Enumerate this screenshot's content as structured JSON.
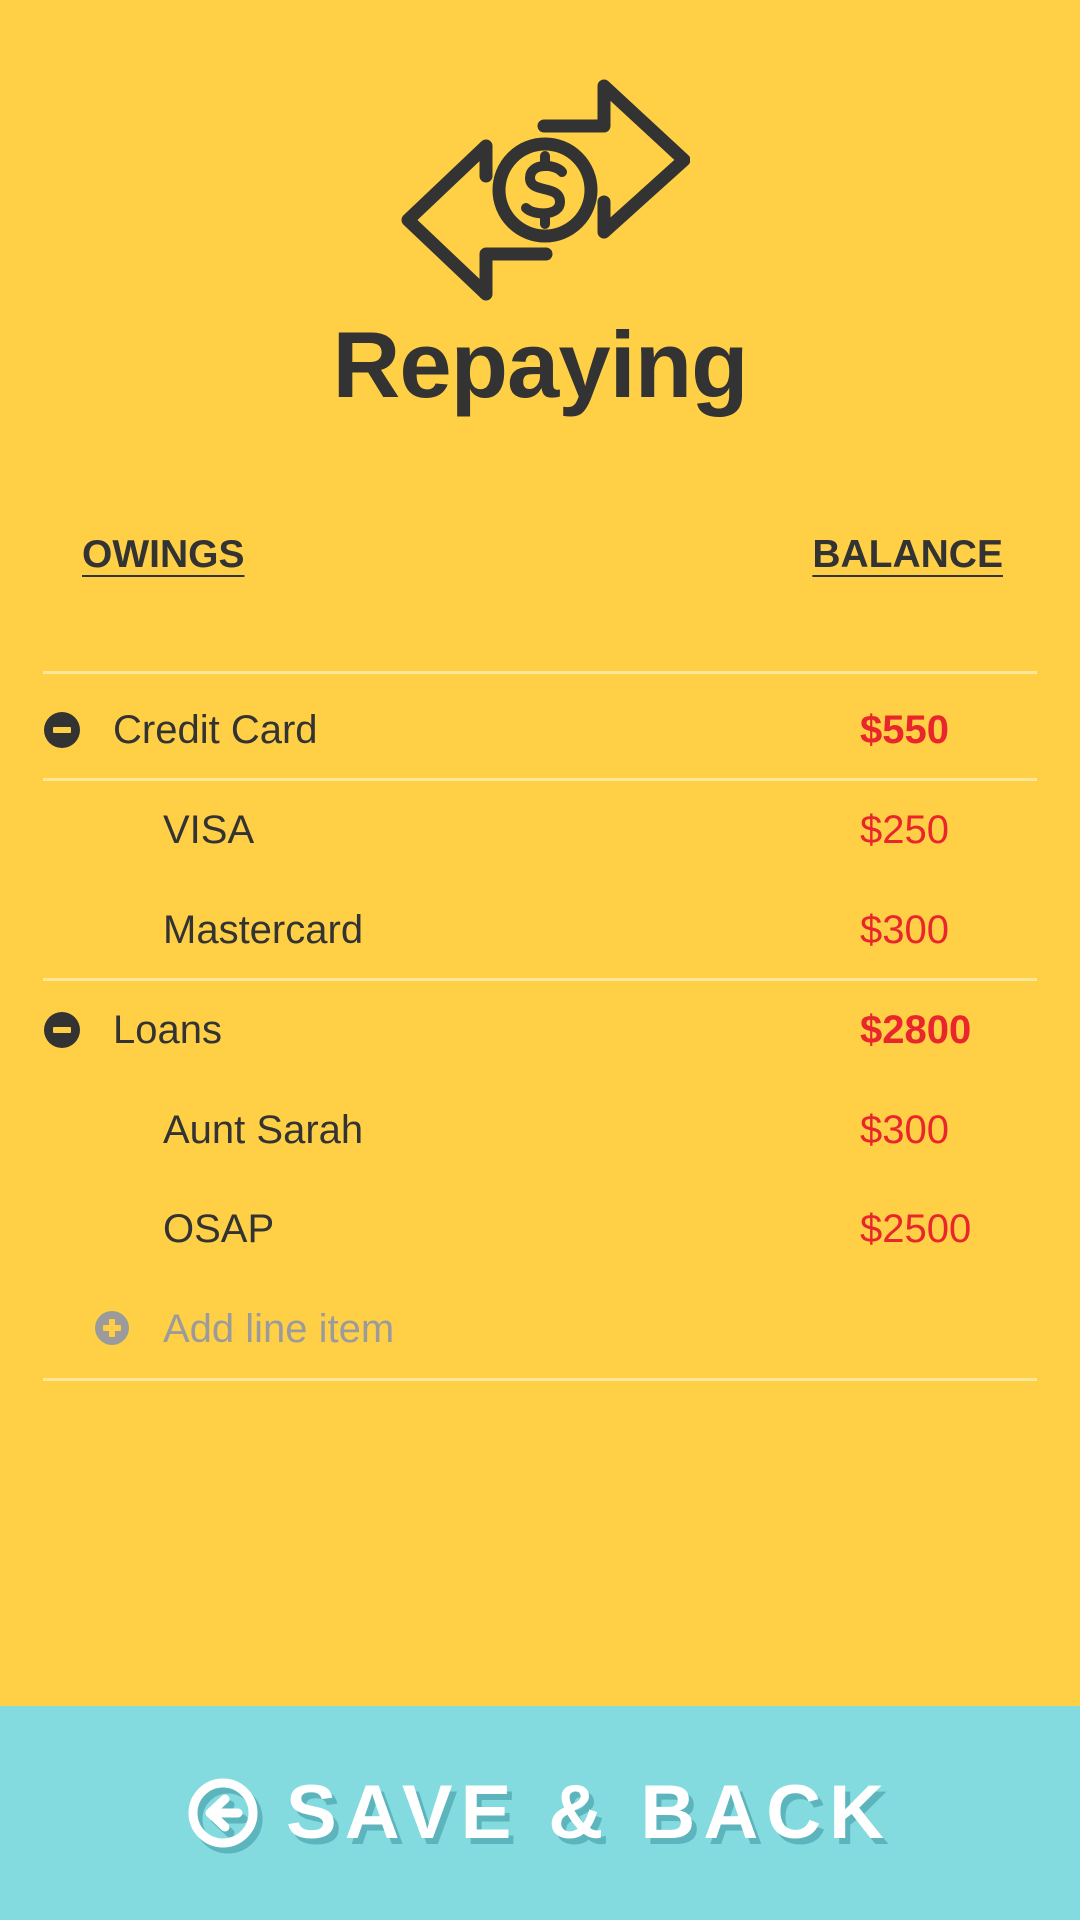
{
  "page": {
    "title": "Repaying",
    "icon": "money-exchange-icon",
    "background_color": "#FFD046"
  },
  "columns": {
    "left": "OWINGS",
    "right": "BALANCE"
  },
  "groups": [
    {
      "label": "Credit Card",
      "total": "$550",
      "icon": "collapse-minus-icon",
      "items": [
        {
          "label": "VISA",
          "amount": "$250"
        },
        {
          "label": "Mastercard",
          "amount": "$300"
        }
      ]
    },
    {
      "label": "Loans",
      "total": "$2800",
      "icon": "collapse-minus-icon",
      "items": [
        {
          "label": "Aunt Sarah",
          "amount": "$300"
        },
        {
          "label": "OSAP",
          "amount": "$2500"
        }
      ]
    }
  ],
  "add_item": {
    "label": "Add line item",
    "icon": "add-plus-icon"
  },
  "footer": {
    "label": "SAVE & BACK",
    "icon": "back-arrow-circle-icon",
    "background_color": "#83DBDF"
  },
  "colors": {
    "text": "#333333",
    "amount": "#E8262B",
    "placeholder": "#9B9B9B",
    "divider": "#FFE79A"
  }
}
